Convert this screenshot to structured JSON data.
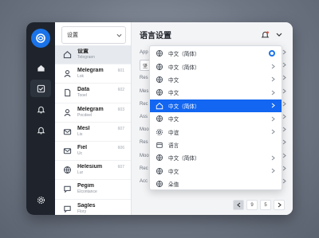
{
  "list": {
    "header": "设置",
    "items": [
      {
        "title": "设置",
        "sub": "Telegraen",
        "num": "",
        "icon": "home-icon"
      },
      {
        "title": "Melegram",
        "sub": "Lok",
        "num": "601",
        "icon": "person-icon"
      },
      {
        "title": "Data",
        "sub": "Tooel",
        "num": "602",
        "icon": "file-icon"
      },
      {
        "title": "Melegram",
        "sub": "Pocdeel",
        "num": "603",
        "icon": "person-icon"
      },
      {
        "title": "Mesl",
        "sub": "Lis",
        "num": "607",
        "icon": "mail-icon"
      },
      {
        "title": "Fiel",
        "sub": "Uc",
        "num": "606",
        "icon": "mail-icon"
      },
      {
        "title": "Helesium",
        "sub": "Lur",
        "num": "607",
        "icon": "globe-icon"
      },
      {
        "title": "Pegim",
        "sub": "Elcontance",
        "num": "",
        "icon": "chat-icon"
      },
      {
        "title": "Sagles",
        "sub": "Flory",
        "num": "",
        "icon": "chat-icon"
      }
    ]
  },
  "main": {
    "title": "语言设置",
    "rows": [
      "App",
      "",
      "Res",
      "Mes",
      "Rec",
      "Ass",
      "Moo",
      "Res",
      "Moo",
      "Rec",
      "Acc"
    ],
    "select_value": "坚"
  },
  "dropdown": {
    "items": [
      {
        "label": "中文（简体）",
        "icon": "globe-icon",
        "trail": "radio"
      },
      {
        "label": "中文（简体）",
        "icon": "globe-icon",
        "trail": "chevron"
      },
      {
        "label": "中文",
        "icon": "globe-icon",
        "trail": "chevron"
      },
      {
        "label": "中文",
        "icon": "globe-icon",
        "trail": "chevron"
      },
      {
        "label": "中文（简体）",
        "icon": "home-icon",
        "trail": "chevron",
        "selected": true
      },
      {
        "label": "中文",
        "icon": "globe-icon",
        "trail": "chevron"
      },
      {
        "label": "中谊",
        "icon": "gear-icon",
        "trail": "chevron"
      },
      {
        "label": "语言",
        "icon": "box-icon",
        "trail": ""
      },
      {
        "label": "中文（简体）",
        "icon": "globe-icon",
        "trail": "chevron"
      },
      {
        "label": "中文",
        "icon": "globe-icon",
        "trail": "chevron"
      },
      {
        "label": "朵值",
        "icon": "globe-icon",
        "trail": ""
      }
    ]
  },
  "pager": {
    "page": "9",
    "next": "5"
  },
  "colors": {
    "accent": "#1266f1",
    "rail": "#1f242c"
  }
}
